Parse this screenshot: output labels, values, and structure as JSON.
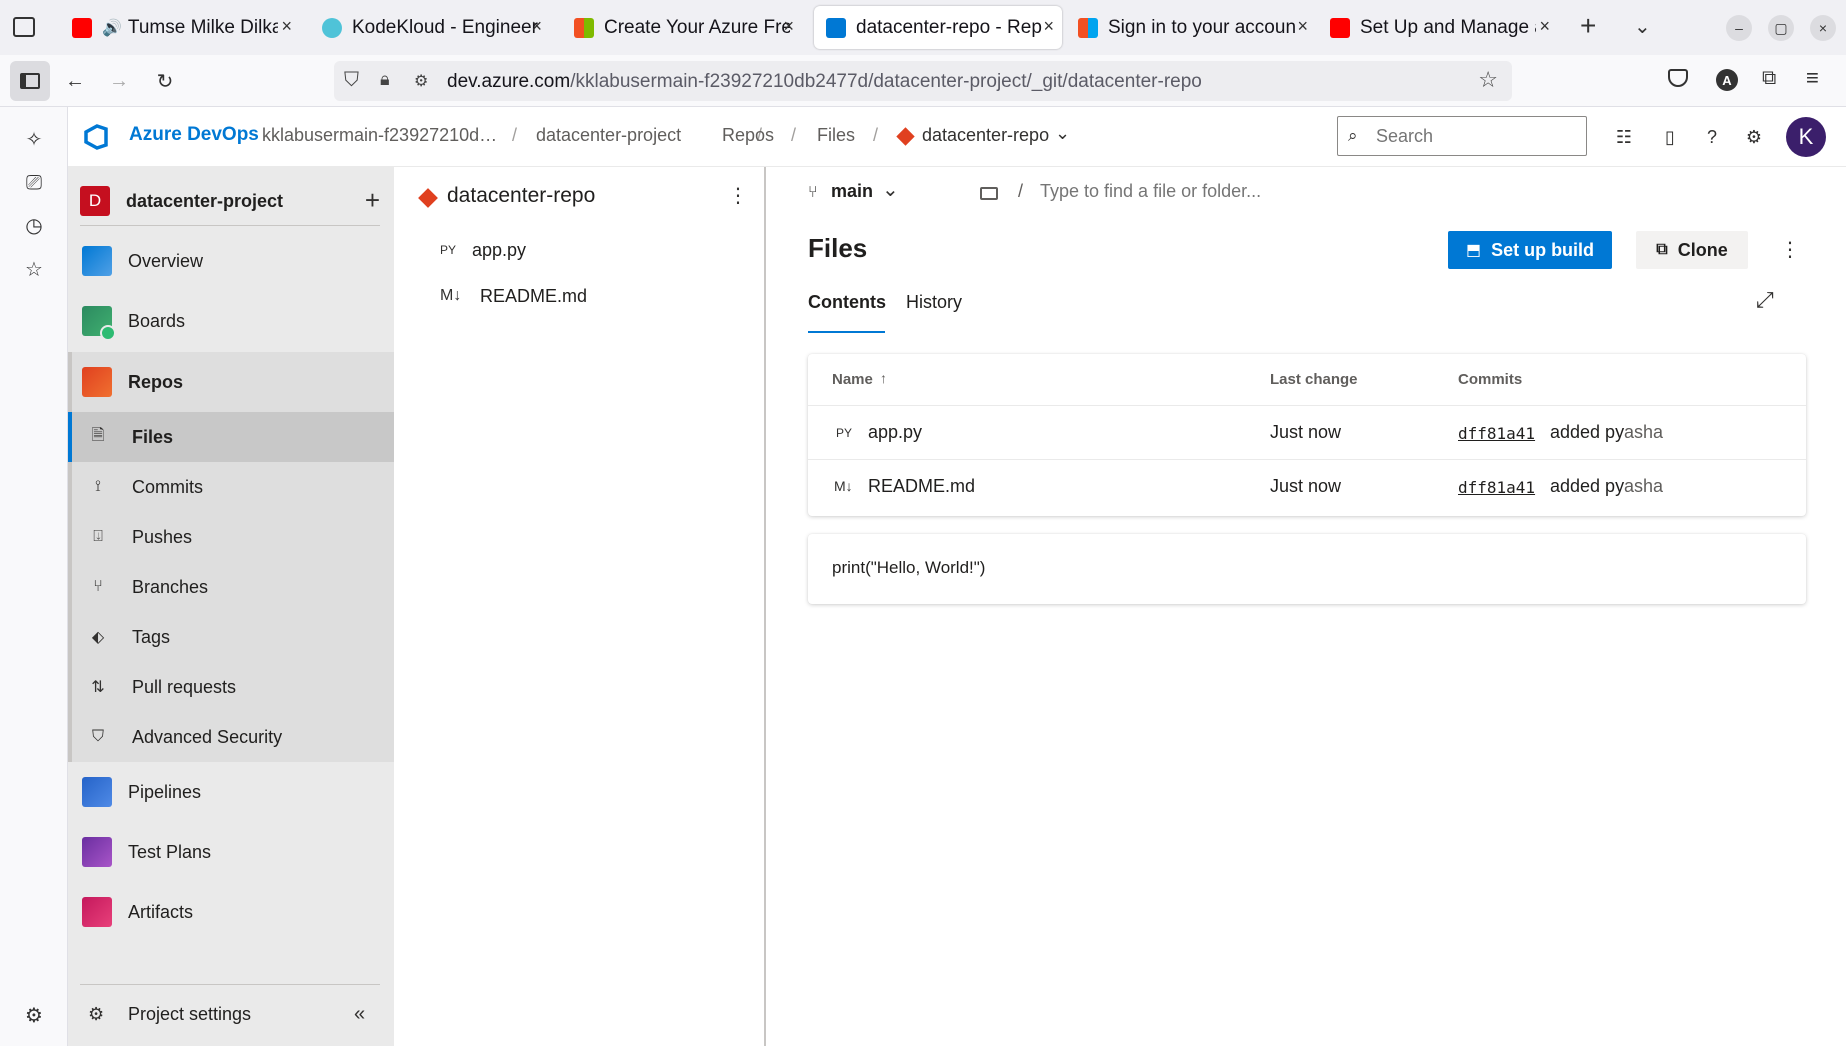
{
  "browser": {
    "tabs": [
      {
        "label": "Tumse Milke Dilka"
      },
      {
        "label": "KodeKloud - Engineer"
      },
      {
        "label": "Create Your Azure Fre"
      },
      {
        "label": "datacenter-repo - Rep"
      },
      {
        "label": "Sign in to your accoun"
      },
      {
        "label": "Set Up and Manage a"
      }
    ],
    "url_host": "dev.azure.com",
    "url_path": "/kklabusermain-f23927210db2477d/datacenter-project/_git/datacenter-repo",
    "profile_initial": "A"
  },
  "header": {
    "brand": "Azure DevOps",
    "breadcrumbs": [
      "kklabusermain-f23927210d…",
      "datacenter-project",
      "Repos",
      "Files",
      "datacenter-repo"
    ],
    "search_placeholder": "Search",
    "avatar_initial": "K"
  },
  "project": {
    "badge": "D",
    "name": "datacenter-project",
    "nav": [
      {
        "label": "Overview"
      },
      {
        "label": "Boards"
      },
      {
        "label": "Repos"
      }
    ],
    "repos_sub": [
      {
        "label": "Files"
      },
      {
        "label": "Commits"
      },
      {
        "label": "Pushes"
      },
      {
        "label": "Branches"
      },
      {
        "label": "Tags"
      },
      {
        "label": "Pull requests"
      },
      {
        "label": "Advanced Security"
      }
    ],
    "nav_bottom": [
      {
        "label": "Pipelines"
      },
      {
        "label": "Test Plans"
      },
      {
        "label": "Artifacts"
      }
    ],
    "settings_label": "Project settings"
  },
  "tree": {
    "repo_name": "datacenter-repo",
    "files": [
      {
        "type": "PY",
        "name": "app.py"
      },
      {
        "type": "M↓",
        "name": "README.md"
      }
    ]
  },
  "main": {
    "branch": "main",
    "path_placeholder": "Type to find a file or folder...",
    "title": "Files",
    "setup_build_label": "Set up build",
    "clone_label": "Clone",
    "tabs": [
      "Contents",
      "History"
    ],
    "columns": {
      "name": "Name",
      "last_change": "Last change",
      "commits": "Commits"
    },
    "rows": [
      {
        "type": "PY",
        "name": "app.py",
        "last_change": "Just now",
        "commit": "dff81a41",
        "message": "added py",
        "author": "asha"
      },
      {
        "type": "M↓",
        "name": "README.md",
        "last_change": "Just now",
        "commit": "dff81a41",
        "message": "added py",
        "author": "asha"
      }
    ],
    "preview": "print(\"Hello, World!\")"
  },
  "colors": {
    "accent": "#0078d4",
    "project_badge": "#c50f1f",
    "avatar": "#3b1f6b",
    "nav_background": "#eaeaea"
  }
}
